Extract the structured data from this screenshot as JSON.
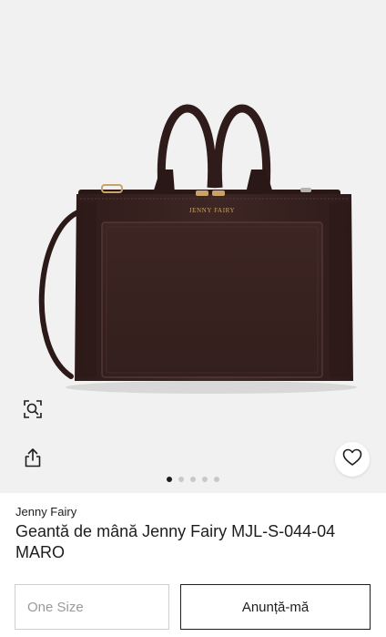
{
  "gallery": {
    "bag_logo_text": "JENNY FAIRY",
    "slides_total": 5,
    "active_slide": 1,
    "colors": {
      "background": "#f1f1f1",
      "bag": "#3b2422",
      "hardware": "#c9a36a"
    },
    "icons": {
      "zoom": "zoom-icon",
      "share": "share-icon",
      "favorite": "heart-icon"
    }
  },
  "product": {
    "brand": "Jenny Fairy",
    "title": "Geantă de mână Jenny Fairy MJL-S-044-04 MARO"
  },
  "actions": {
    "size_placeholder": "One Size",
    "notify_label": "Anunță-mă"
  }
}
